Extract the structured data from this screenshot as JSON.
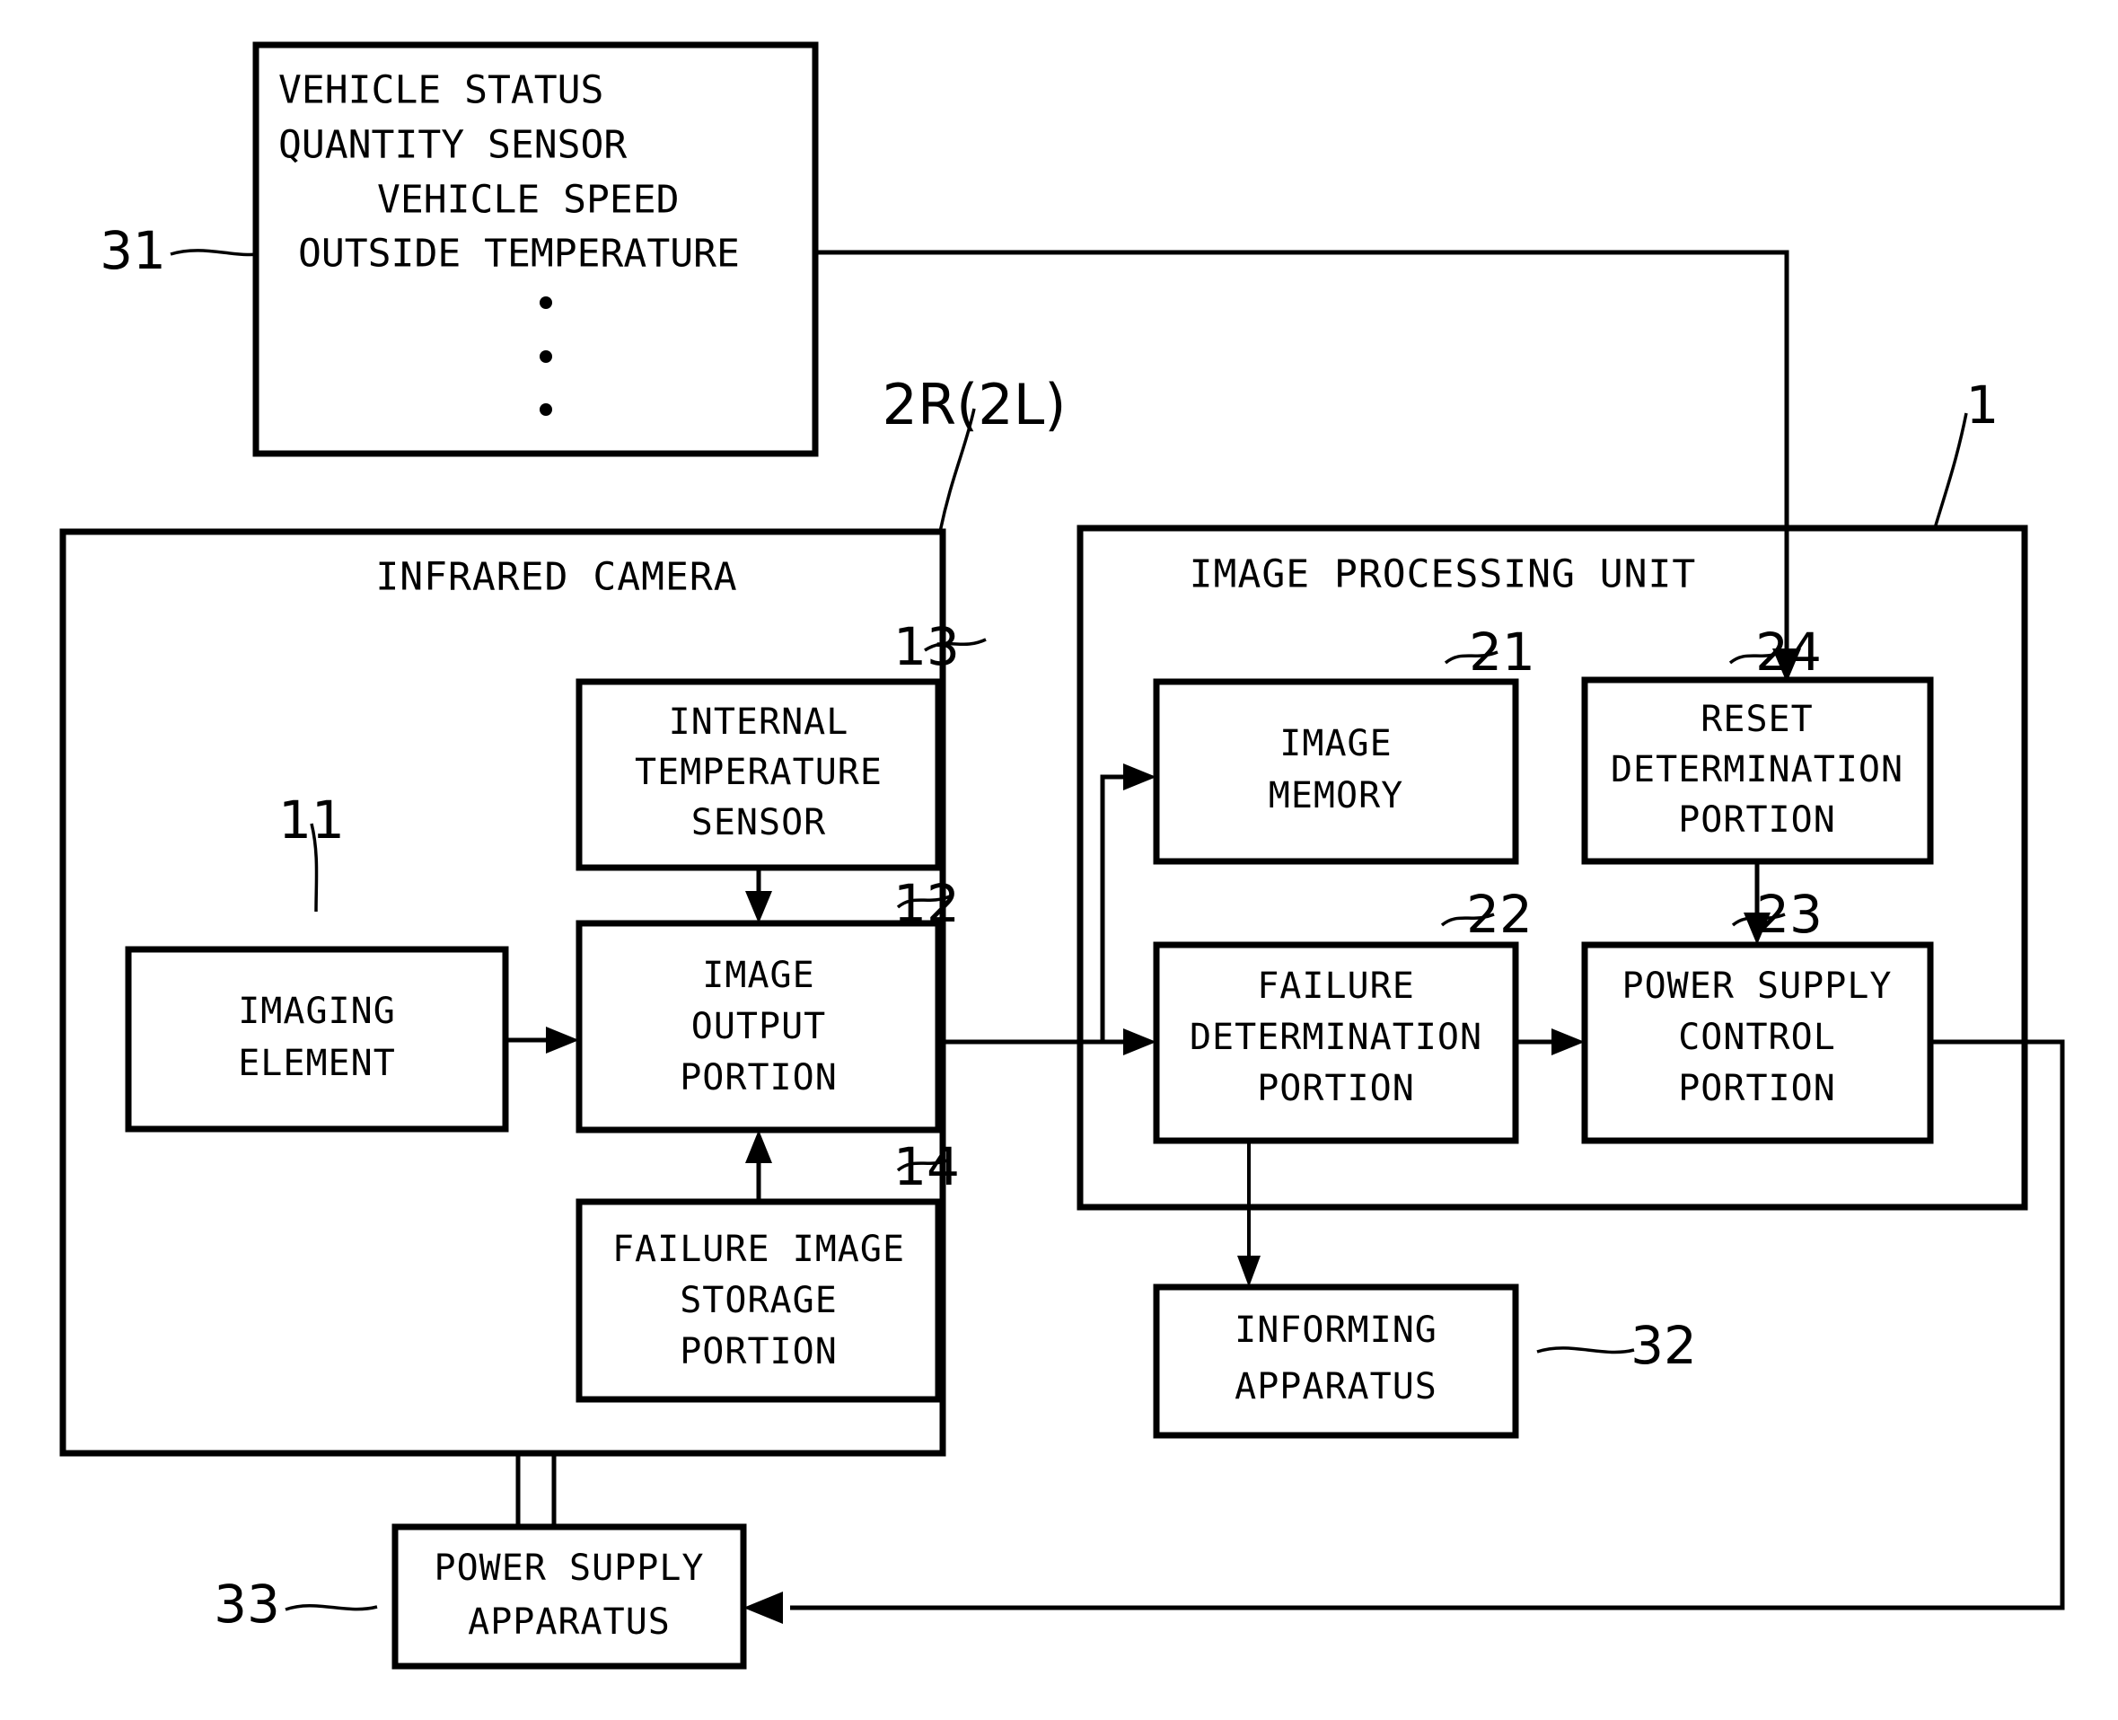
{
  "figure": {
    "type": "patent-block-diagram",
    "background": "#ffffff",
    "ink": "#000000"
  },
  "sensor_box": {
    "ref": "31",
    "lines": [
      "VEHICLE STATUS",
      "QUANTITY SENSOR",
      "VEHICLE SPEED",
      "OUTSIDE TEMPERATURE"
    ],
    "ellipsis": "•"
  },
  "camera": {
    "ref": "2R(2L)",
    "title": "INFRARED CAMERA",
    "blocks": [
      {
        "ref": "13",
        "label": "INTERNAL\nTEMPERATURE\nSENSOR",
        "lines": [
          "INTERNAL",
          "TEMPERATURE",
          "SENSOR"
        ]
      },
      {
        "ref": "11",
        "label": "IMAGING ELEMENT",
        "lines": [
          "IMAGING",
          "ELEMENT"
        ]
      },
      {
        "ref": "12",
        "label": "IMAGE OUTPUT PORTION",
        "lines": [
          "IMAGE",
          "OUTPUT",
          "PORTION"
        ]
      },
      {
        "ref": "14",
        "label": "FAILURE IMAGE STORAGE PORTION",
        "lines": [
          "FAILURE IMAGE",
          "STORAGE",
          "PORTION"
        ]
      }
    ]
  },
  "processing_unit": {
    "ref": "1",
    "title": "IMAGE PROCESSING UNIT",
    "blocks": [
      {
        "ref": "21",
        "label": "IMAGE MEMORY",
        "lines": [
          "IMAGE",
          "MEMORY"
        ]
      },
      {
        "ref": "24",
        "label": "RESET DETERMINATION PORTION",
        "lines": [
          "RESET",
          "DETERMINATION",
          "PORTION"
        ]
      },
      {
        "ref": "22",
        "label": "FAILURE DETERMINATION PORTION",
        "lines": [
          "FAILURE",
          "DETERMINATION",
          "PORTION"
        ]
      },
      {
        "ref": "23",
        "label": "POWER SUPPLY CONTROL PORTION",
        "lines": [
          "POWER SUPPLY",
          "CONTROL",
          "PORTION"
        ]
      }
    ]
  },
  "informing_apparatus": {
    "ref": "32",
    "lines": [
      "INFORMING",
      "APPARATUS"
    ]
  },
  "power_supply_apparatus": {
    "ref": "33",
    "lines": [
      "POWER SUPPLY",
      "APPARATUS"
    ]
  }
}
